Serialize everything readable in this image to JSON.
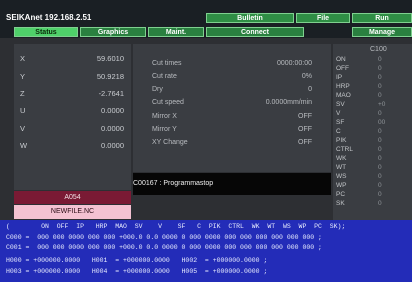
{
  "app_title": "SEIKAnet 192.168.2.51",
  "nav_top": [
    "Bulletin",
    "File",
    "Run"
  ],
  "nav_bottom": [
    "Status",
    "Graphics",
    "Maint.",
    "Connect",
    "Manage"
  ],
  "axes": [
    {
      "label": "X",
      "value": "59.6010"
    },
    {
      "label": "Y",
      "value": "50.9218"
    },
    {
      "label": "Z",
      "value": "-2.7641"
    },
    {
      "label": "U",
      "value": "0.0000"
    },
    {
      "label": "V",
      "value": "0.0000"
    },
    {
      "label": "W",
      "value": "0.0000"
    }
  ],
  "machining": [
    {
      "label": "Cut times",
      "value": "0000:00:00"
    },
    {
      "label": "Cut rate",
      "value": "0%"
    },
    {
      "label": "Dry",
      "value": "0"
    },
    {
      "label": "Cut speed",
      "value": "0.0000mm/min"
    },
    {
      "label": "Mirror X",
      "value": "OFF"
    },
    {
      "label": "Mirror Y",
      "value": "OFF"
    },
    {
      "label": "XY Change",
      "value": "OFF"
    }
  ],
  "message": "C00167 : Programmastop",
  "program_number": "A054",
  "file_name": "NEWFILE.NC",
  "code_header": "C100",
  "codes": [
    {
      "label": "ON",
      "value": "0"
    },
    {
      "label": "OFF",
      "value": "0"
    },
    {
      "label": "IP",
      "value": "0"
    },
    {
      "label": "HRP",
      "value": "0"
    },
    {
      "label": "MAO",
      "value": "0"
    },
    {
      "label": "SV",
      "value": "+0"
    },
    {
      "label": "V",
      "value": "0"
    },
    {
      "label": "SF",
      "value": "00"
    },
    {
      "label": "C",
      "value": "0"
    },
    {
      "label": "PIK",
      "value": "0"
    },
    {
      "label": "CTRL",
      "value": "0"
    },
    {
      "label": "WK",
      "value": "0"
    },
    {
      "label": "WT",
      "value": "0"
    },
    {
      "label": "WS",
      "value": "0"
    },
    {
      "label": "WP",
      "value": "0"
    },
    {
      "label": "PC",
      "value": "0"
    },
    {
      "label": "SK",
      "value": "0"
    }
  ],
  "table_header": "(        ON  OFF  IP   HRP  MAO  SV    V    SF   C  PIK  CTRL  WK  WT  WS  WP  PC  SK);",
  "table_rows": [
    "C000 =  000 000 0000 000 000 +000.0 0.0 0000 0 000 0000 000 000 000 000 000 000 ;",
    "C001 =  000 000 0000 000 000 +000.0 0.0 0000 0 000 0000 000 000 000 000 000 000 ;",
    "H000 = +000000.0000   H001  = +000000.0000   H002  = +000000.0000 ;",
    "H003 = +000000.0000   H004  = +000000.0000   H005  = +000000.0000 ;"
  ]
}
